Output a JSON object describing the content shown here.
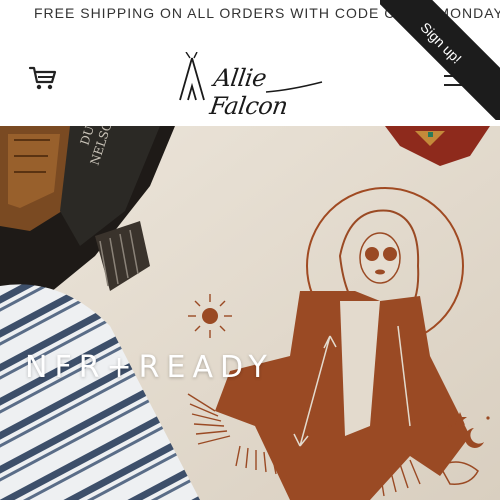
{
  "announcement": {
    "text": "FREE SHIPPING ON ALL ORDERS WITH CODE CYBERMONDAY"
  },
  "header": {
    "logo_text": "Allie Falcon",
    "cart_icon": "cart-icon",
    "menu_icon": "hamburger-menu-icon"
  },
  "signup": {
    "label": "Sign up!"
  },
  "hero": {
    "title": "NFR+READY",
    "book_spine_text": "NELSON\nDUST"
  },
  "colors": {
    "rust": "#9a4a24",
    "shirt": "#e7dfd2",
    "ribbon": "#1c1c1c"
  }
}
